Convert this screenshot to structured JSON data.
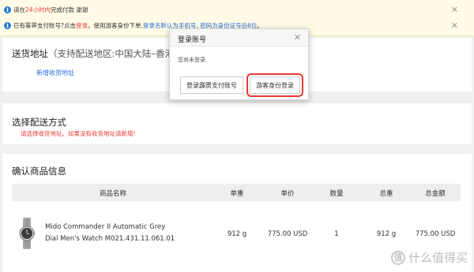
{
  "notices": [
    {
      "prefix": "请在",
      "highlight": "24小时内",
      "suffix": "完成付款 谢谢"
    },
    {
      "prefix": "已有雾霁支付账号?点击",
      "login_link": "登录",
      "mid": "。使用游客身份下单,",
      "blue_text": "登录名默认为手机号, 密码为身份证号后6位",
      "suffix": "。"
    }
  ],
  "shipping": {
    "title": "送货地址",
    "hint": "（支持配送地区:中国大陆–香港(可",
    "add_link": "新增收货地址"
  },
  "delivery": {
    "title": "选择配送方式",
    "warning": "请选择收货地址。如果没有收货地址请新增!"
  },
  "products": {
    "title": "确认商品信息",
    "headers": [
      "商品名称",
      "单重",
      "单价",
      "数量",
      "总重",
      "总金额"
    ],
    "rows": [
      {
        "name_line1": "Mido Commander II Automatic Grey",
        "name_line2": "Dial Men's Watch M021.431.11.061.01",
        "unit_weight": "912 g",
        "unit_price": "775.00 USD",
        "qty": "1",
        "total_weight": "912 g",
        "total_price": "775.00 USD"
      }
    ]
  },
  "modal": {
    "title": "登录账号",
    "body": "您尚未登录.",
    "login_button": "登录霹雳支付账号",
    "guest_button": "游客身份登录"
  },
  "watermark": {
    "logo": "值",
    "text": "什么值得买"
  },
  "colors": {
    "accent_red": "#e53935",
    "link_blue": "#2a6fd6",
    "notice_bg": "#fffbe6"
  }
}
